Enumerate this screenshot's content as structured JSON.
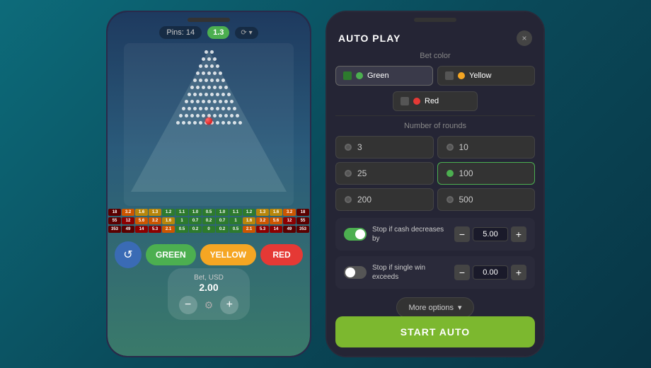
{
  "left_phone": {
    "pins_label": "Pins: 14",
    "pins_value": "1.3",
    "game": {
      "ball_visible": true
    },
    "score_rows": {
      "row1": [
        "18",
        "3.2",
        "1.6",
        "1.3",
        "1.2",
        "1.1",
        "1.0",
        "0.5",
        "1.0",
        "1.1",
        "1.2",
        "1.3",
        "1.6",
        "3.2",
        "18"
      ],
      "row2": [
        "55",
        "12",
        "5.6",
        "3.2",
        "1.6",
        "1",
        "0.7",
        "0.2",
        "0.7",
        "1",
        "1.6",
        "3.2",
        "5.6",
        "12",
        "55"
      ],
      "row3": [
        "353",
        "49",
        "14",
        "5.3",
        "2.1",
        "0.5",
        "0.2",
        "0",
        "0.2",
        "0.5",
        "2.1",
        "5.3",
        "14",
        "49",
        "353"
      ]
    },
    "buttons": {
      "green": "GREEN",
      "yellow": "YELLOW",
      "red": "RED"
    },
    "bet": {
      "label": "Bet, USD",
      "value": "2.00"
    }
  },
  "auto_play": {
    "title": "AUTO PLAY",
    "close_label": "×",
    "bet_color_section": "Bet color",
    "colors": [
      {
        "name": "Green",
        "checked": true,
        "dot_color": "#4caf50"
      },
      {
        "name": "Yellow",
        "checked": false,
        "dot_color": "#f5a623"
      },
      {
        "name": "Red",
        "checked": false,
        "dot_color": "#e53935"
      }
    ],
    "rounds_section": "Number of rounds",
    "rounds": [
      {
        "value": "3",
        "selected": false
      },
      {
        "value": "10",
        "selected": false
      },
      {
        "value": "25",
        "selected": false
      },
      {
        "value": "100",
        "selected": true
      },
      {
        "value": "200",
        "selected": false
      },
      {
        "value": "500",
        "selected": false
      }
    ],
    "stop_conditions": [
      {
        "enabled": true,
        "label": "Stop if cash decreases by",
        "value": "5.00"
      },
      {
        "enabled": false,
        "label": "Stop if single win exceeds",
        "value": "0.00"
      }
    ],
    "more_options_label": "More options",
    "start_auto_label": "START AUTO"
  }
}
